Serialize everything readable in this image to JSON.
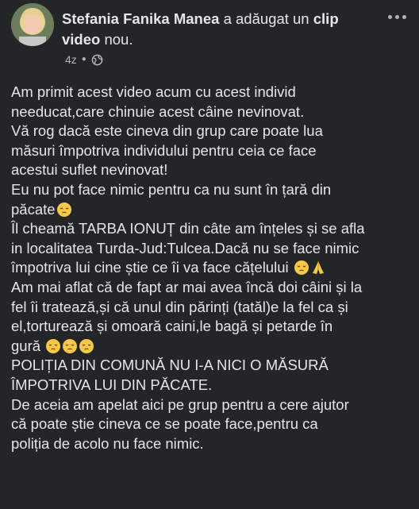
{
  "post": {
    "author": "Stefania Fanika Manea",
    "action_prefix": " a adăugat un ",
    "action_object": "clip video",
    "action_suffix": " nou.",
    "time": "4z",
    "privacy_icon": "globe-icon",
    "more_icon": "more-options-icon",
    "lines": [
      "Am primit acest video acum cu acest individ",
      "needucat,care chinuie acest câine nevinovat.",
      "Vă rog dacă este cineva din grup care poate lua",
      "măsuri împotriva individului pentru ceia ce face",
      "acestui suflet nevinovat!",
      "Eu nu pot face nimic pentru ca nu sunt în țară din",
      "păcate",
      "Îl cheamă TARBA IONUȚ din câte am înțeles și se afla",
      "in localitatea Turda-Jud:Tulcea.Dacă nu se face nimic",
      "împotriva lui cine știe ce îi va face cățelului",
      "Am mai aflat că de fapt ar mai avea încă doi câini și la",
      "fel îi tratează,și că unul din părinți (tatăl)e la fel ca și",
      "el,torturează și omoară caini,le bagă și petarde în",
      "gură",
      "POLIȚIA DIN COMUNĂ NU I-A NICI O MĂSURĂ",
      "ÎMPOTRIVA LUI DIN PĂCATE.",
      "De aceia am apelat aici pe grup pentru a cere ajutor",
      "că poate știe cineva ce se poate face,pentru ca",
      "poliția de acolo nu face nimic."
    ]
  },
  "colors": {
    "background": "#242526",
    "text_primary": "#e4e6eb",
    "text_secondary": "#b0b3b8",
    "emoji": "#f7c948"
  }
}
